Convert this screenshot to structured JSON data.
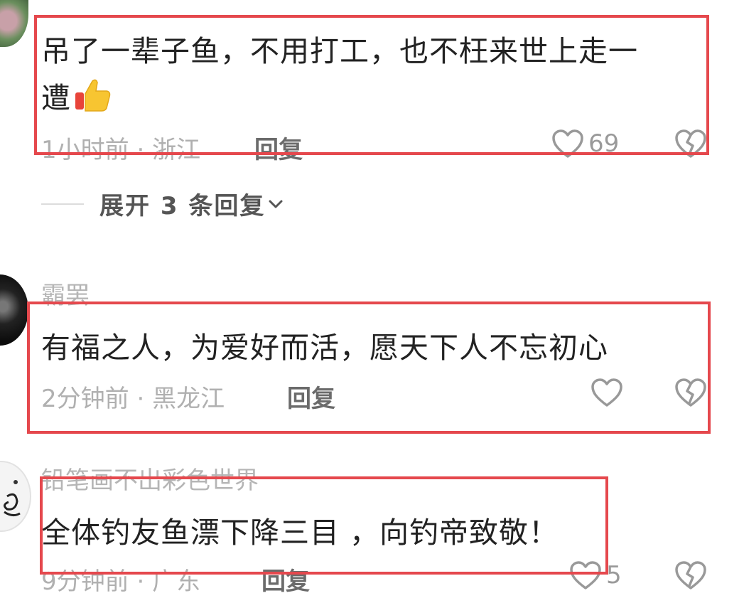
{
  "comments": [
    {
      "username": "",
      "text_line1": "吊了一辈子鱼，不用打工，也不枉来世上走一",
      "text_line2": "遭",
      "emoji_icon": "thumbs-up-emoji",
      "time": "1小时前",
      "region": "浙江",
      "reply_label": "回复",
      "likes": "69"
    },
    {
      "username": "霸罢",
      "text_line1": "有福之人，为爱好而活，愿天下人不忘初心",
      "time": "2分钟前",
      "region": "黑龙江",
      "reply_label": "回复",
      "likes": ""
    },
    {
      "username": "铅笔画不出彩色世界",
      "text_line1": "全体钓友鱼漂下降三目 ，向钓帝致敬！",
      "time": "9分钟前",
      "region": "广东",
      "reply_label": "回复",
      "likes": "5"
    }
  ],
  "expand": {
    "label": "展开 3 条回复"
  },
  "separator": " · ",
  "colors": {
    "highlight_border": "#e5484d",
    "text": "#222222",
    "meta": "#b0b0b0"
  }
}
